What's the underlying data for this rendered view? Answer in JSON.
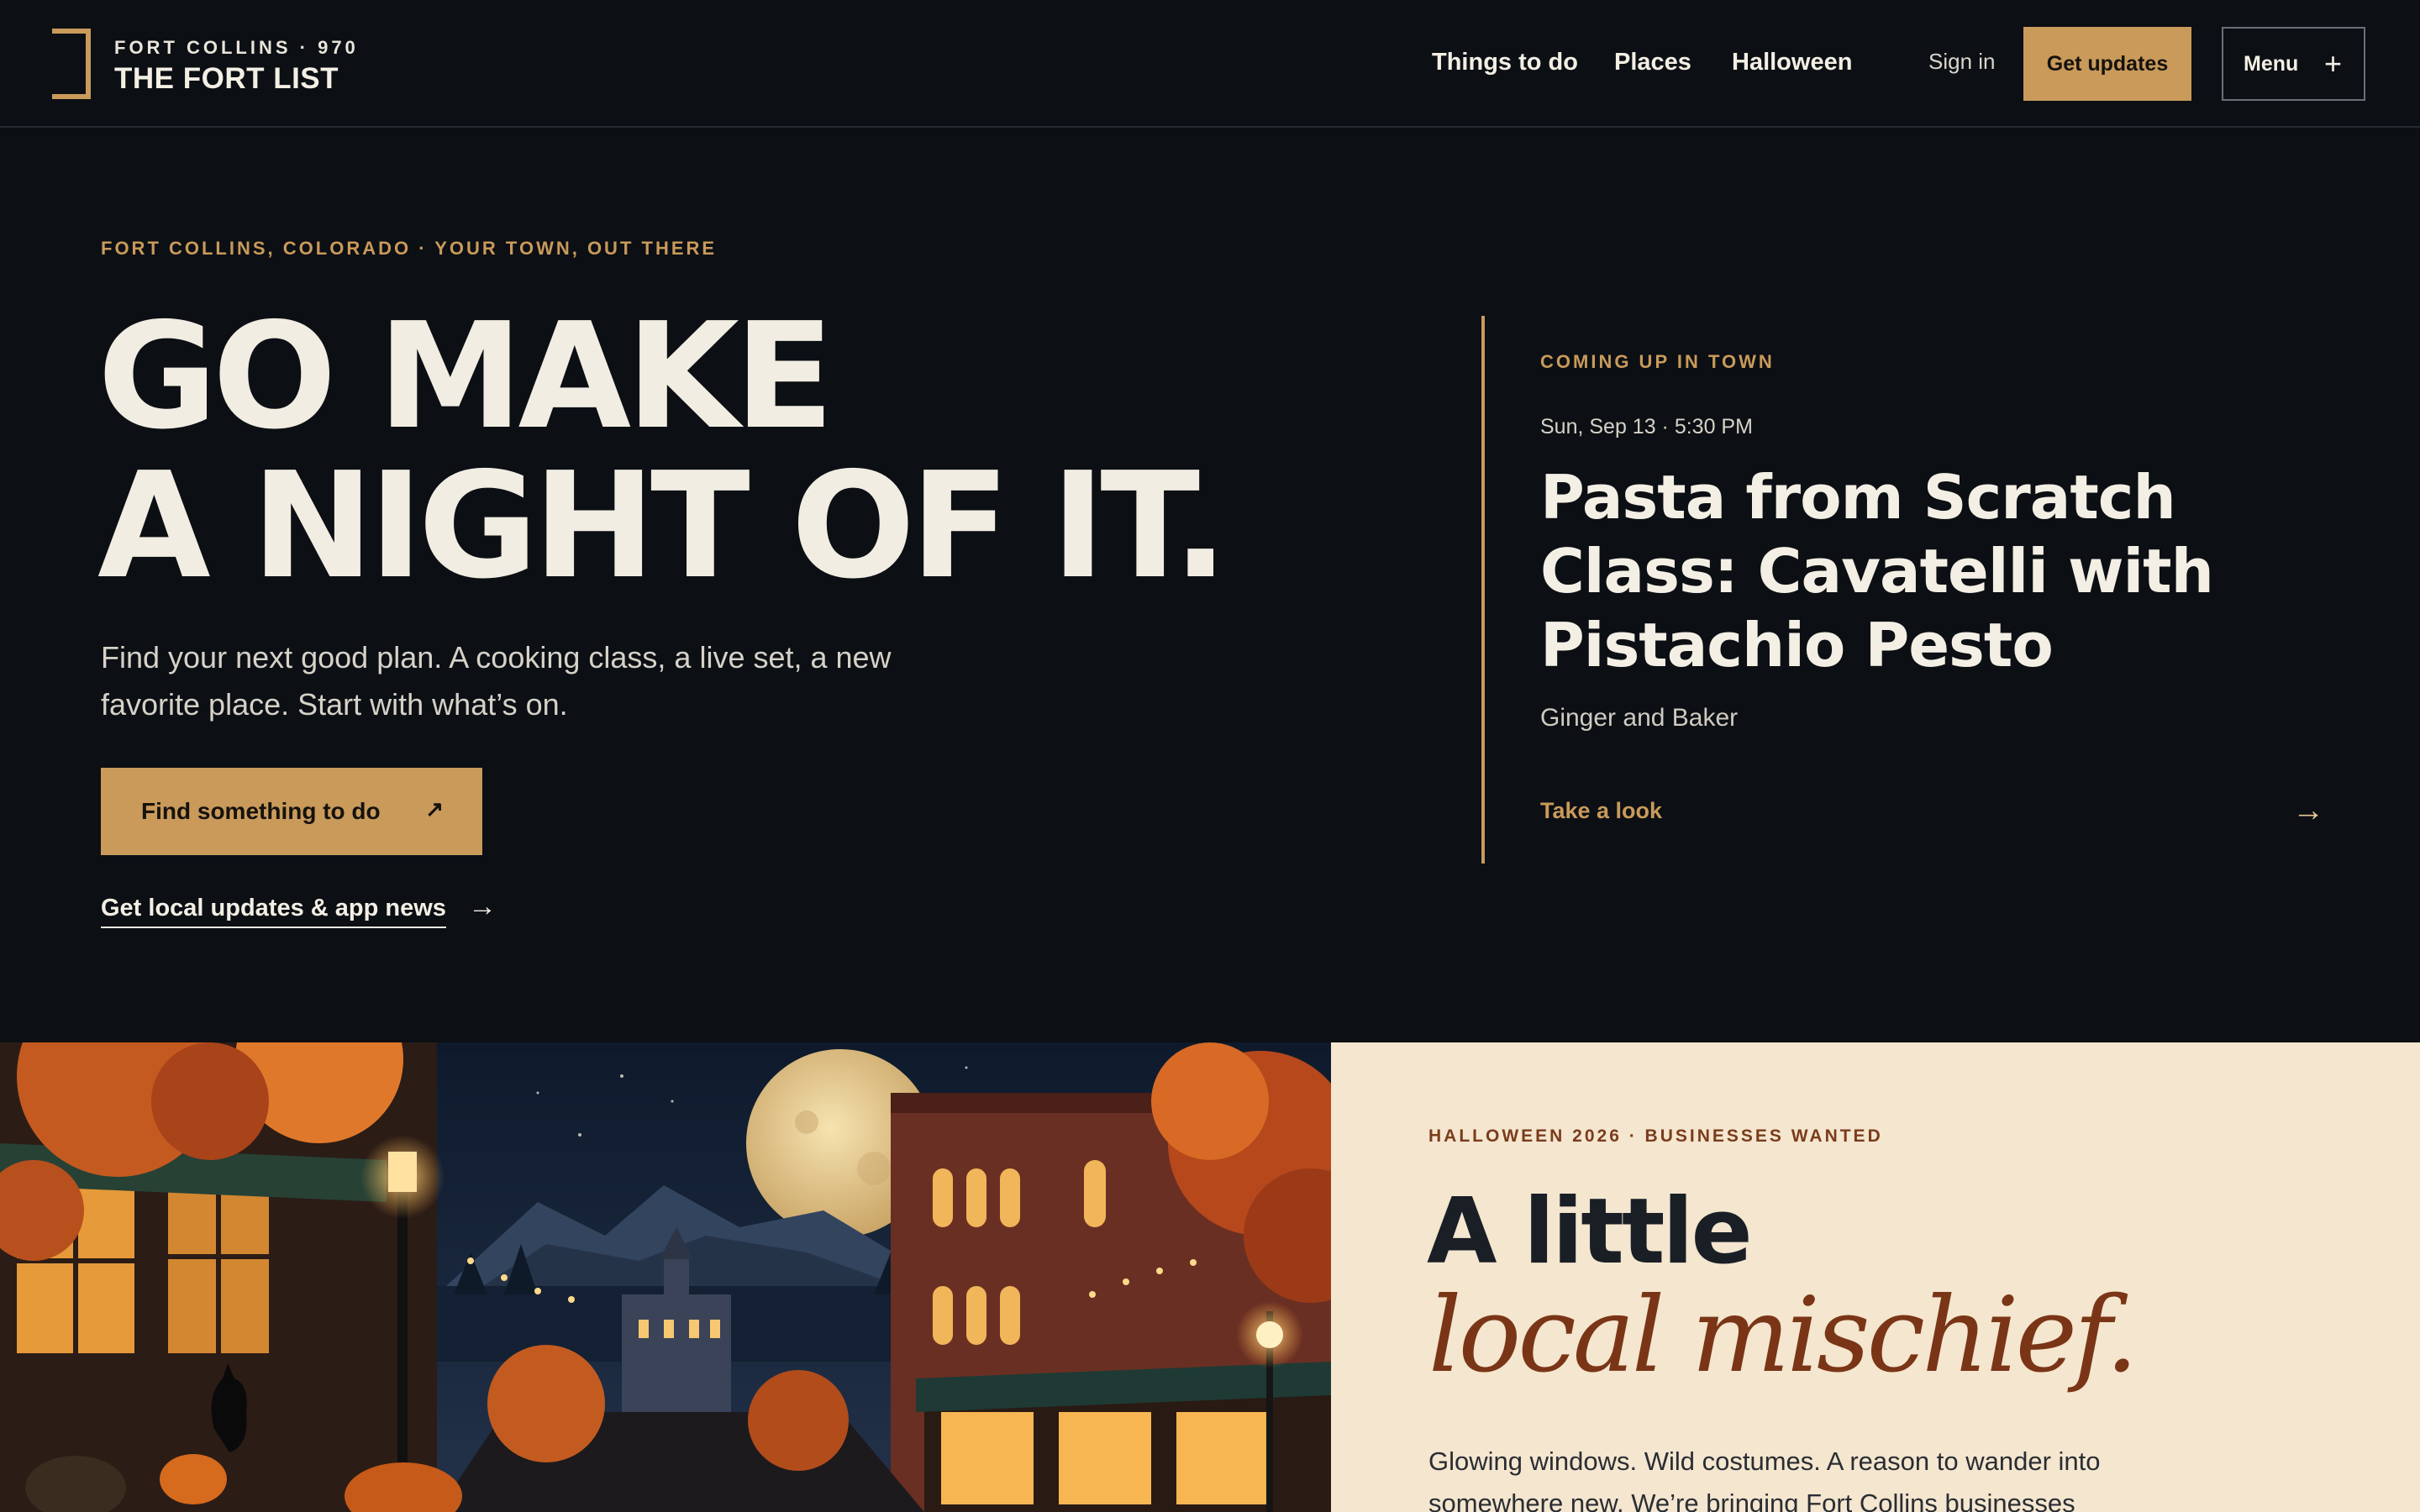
{
  "header": {
    "logo_sub": "FORT COLLINS · 970",
    "logo_title": "THE FORT LIST",
    "nav": [
      "Things to do",
      "Places",
      "Halloween"
    ],
    "sign_in": "Sign in",
    "get_updates": "Get updates",
    "menu": "Menu",
    "menu_icon": "plus-icon"
  },
  "hero": {
    "eyebrow": "FORT COLLINS, COLORADO · YOUR TOWN, OUT THERE",
    "title_line1": "GO MAKE",
    "title_line2": "A NIGHT OF IT.",
    "subtitle": "Find your next good plan. A cooking class, a live set, a new favorite place. Start with what’s on.",
    "cta_label": "Find something to do",
    "cta_icon": "↗",
    "link_label": "Get local updates & app news",
    "link_icon": "→"
  },
  "upcoming": {
    "eyebrow": "COMING UP IN TOWN",
    "date": "Sun, Sep 13 · 5:30 PM",
    "title": "Pasta from Scratch Class: Cavatelli with Pistachio Pesto",
    "venue": "Ginger and Baker",
    "link_label": "Take a look",
    "link_icon": "→"
  },
  "promo": {
    "eyebrow": "HALLOWEEN 2026 · BUSINESSES WANTED",
    "title": "A little",
    "title_italic": "local mischief.",
    "body": "Glowing windows. Wild costumes. A reason to wander into somewhere new. We’re bringing Fort Collins businesses"
  },
  "colors": {
    "background": "#0c0f14",
    "accent": "#c99a5a",
    "text": "#f3efe4",
    "promo_bg": "#f4e6cf",
    "promo_italic": "#7a3517"
  }
}
